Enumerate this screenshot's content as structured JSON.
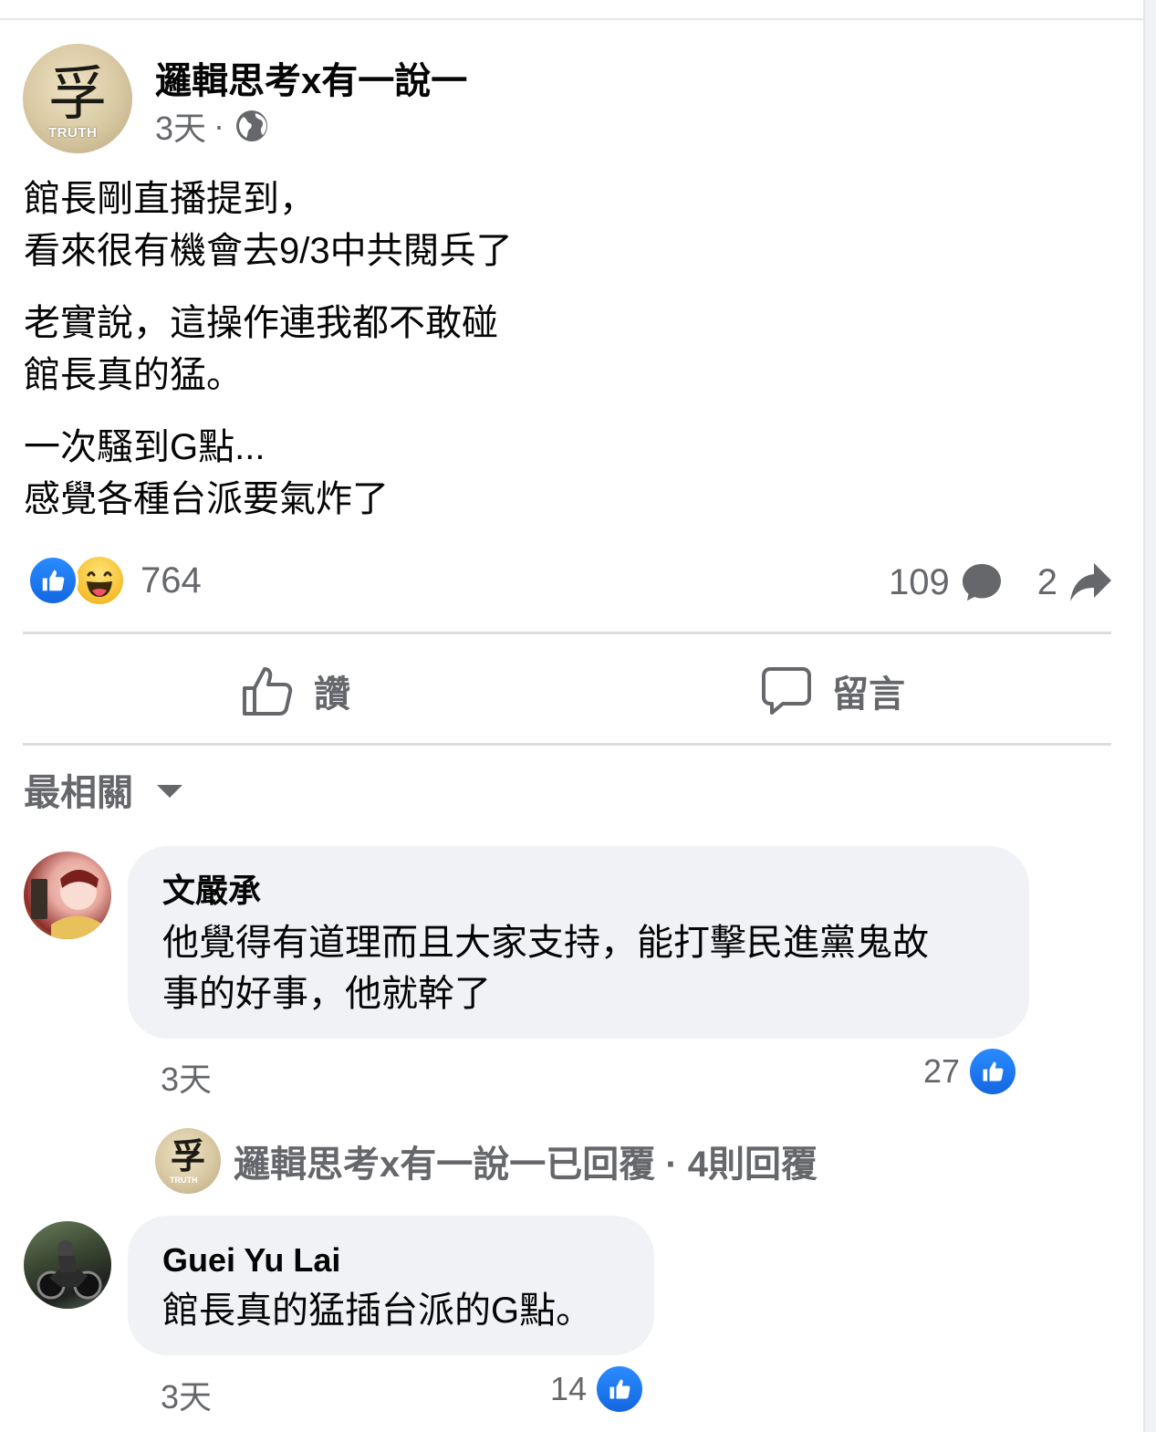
{
  "post": {
    "author": "邏輯思考x有一說一",
    "avatar_glyph": "孚",
    "avatar_caption": "TRUTH",
    "time": "3天",
    "separator": "·",
    "privacy_icon": "globe-icon",
    "paragraphs": [
      "館長剛直播提到，\n看來很有機會去9/3中共閱兵了",
      "老實說，這操作連我都不敢碰\n館長真的猛。",
      "一次騷到G點...\n感覺各種台派要氣炸了"
    ],
    "reaction_count": "764",
    "reaction_icons": [
      "like-icon",
      "haha-icon"
    ],
    "comment_count": "109",
    "share_count": "2"
  },
  "actions": {
    "like_label": "讚",
    "comment_label": "留言"
  },
  "sort": {
    "label": "最相關"
  },
  "comments": [
    {
      "author": "文嚴承",
      "text": "他覺得有道理而且大家支持，能打擊民進黨鬼故\n事的好事，他就幹了",
      "time": "3天",
      "likes": "27"
    },
    {
      "author": "Guei Yu Lai",
      "text": "館長真的猛插台派的G點。",
      "time": "3天",
      "likes": "14"
    }
  ],
  "replies": {
    "text": "邏輯思考x有一說一已回覆 · 4則回覆"
  },
  "colors": {
    "accent": "#1877f2",
    "secondary_text": "#65676b",
    "bubble_bg": "#f0f2f5",
    "divider": "#dadde1"
  }
}
